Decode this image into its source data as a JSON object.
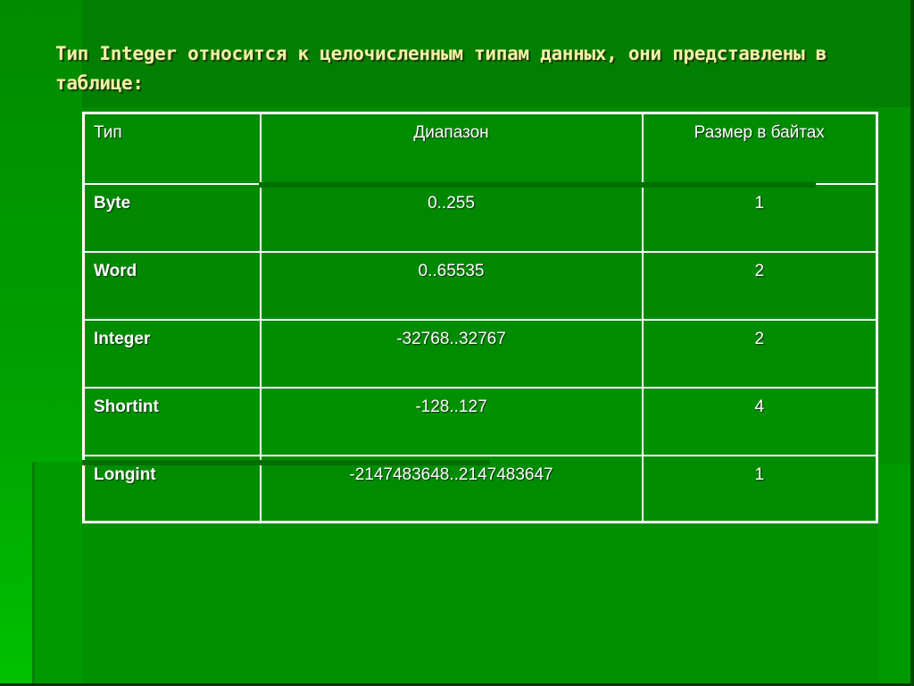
{
  "slide": {
    "title": "Тип Integer относится к целочисленным типам данных, они представлены в таблице:",
    "colors": {
      "background": "#008c00",
      "title_text": "#f4f2a6",
      "table_border": "#ffffff",
      "table_text": "#ffffff"
    }
  },
  "table": {
    "headers": [
      "Тип",
      "Диапазон",
      "Размер в байтах"
    ],
    "rows": [
      {
        "type": "Byte",
        "range": "0..255",
        "size": "1"
      },
      {
        "type": "Word",
        "range": "0..65535",
        "size": "2"
      },
      {
        "type": "Integer",
        "range": "-32768..32767",
        "size": "2"
      },
      {
        "type": "Shortint",
        "range": "-128..127",
        "size": "4"
      },
      {
        "type": "Longint",
        "range": "-2147483648..2147483647",
        "size": "1"
      }
    ]
  }
}
